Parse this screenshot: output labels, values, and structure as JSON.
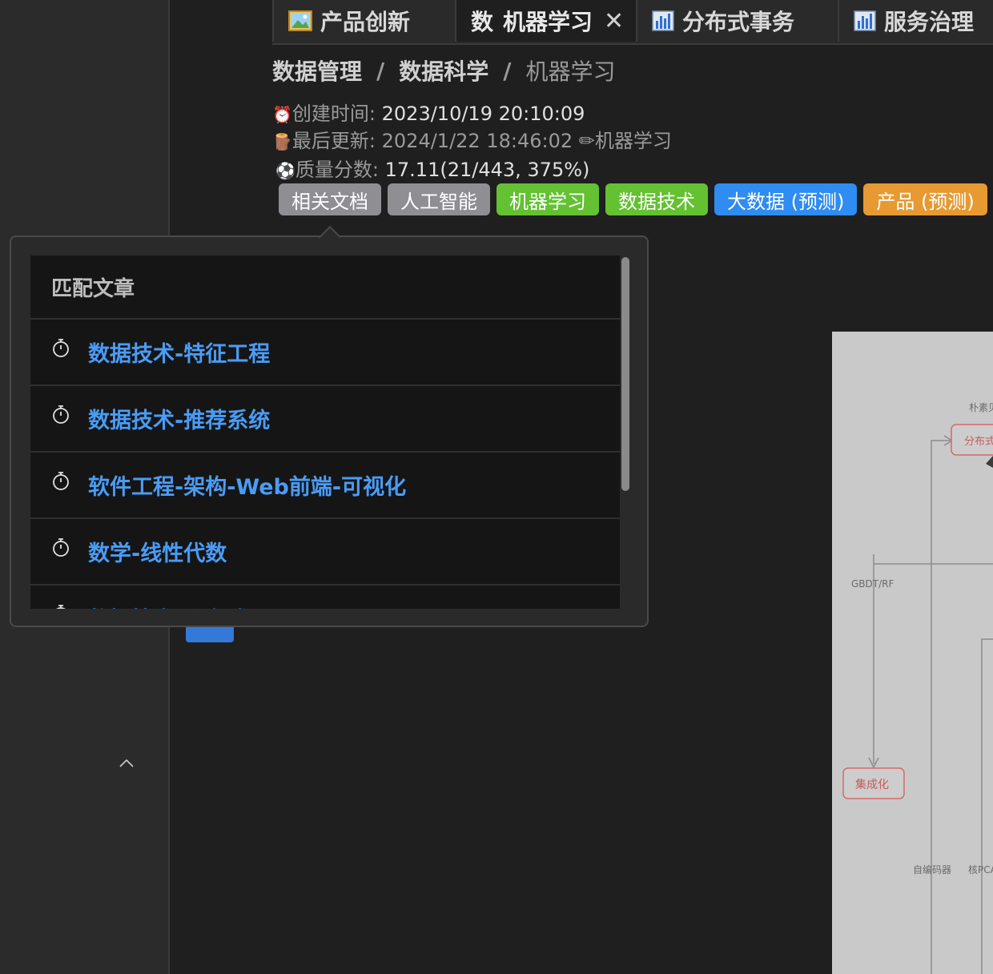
{
  "tabs": [
    {
      "label": "产品创新",
      "icon": "image-icon",
      "active": false
    },
    {
      "label": "机器学习",
      "abbr": "数",
      "active": true,
      "close": "✕"
    },
    {
      "label": "分布式事务",
      "icon": "bar-chart-icon",
      "active": false
    },
    {
      "label": "服务治理",
      "icon": "bar-chart-icon",
      "active": false
    }
  ],
  "breadcrumb": [
    "数据管理",
    "数据科学",
    "机器学习"
  ],
  "breadcrumb_sep": "/",
  "meta": {
    "created_label": "创建时间:",
    "created_value": "2023/10/19 20:10:09",
    "updated_label": "最后更新:",
    "updated_value": "2024/1/22 18:46:02",
    "updated_by": "机器学习",
    "quality_label": "质量分数:",
    "quality_value": "17.11(21/443, 375%)",
    "created_emoji": "⏰",
    "updated_emoji": "🪵",
    "pencil": "✏",
    "quality_emoji": "⚽"
  },
  "tags": [
    {
      "label": "相关文档",
      "color": "#8e8e93"
    },
    {
      "label": "人工智能",
      "color": "#8e8e93"
    },
    {
      "label": "机器学习",
      "color": "#63c132"
    },
    {
      "label": "数据技术",
      "color": "#63c132"
    },
    {
      "label": "大数据 (预测)",
      "color": "#2f8cf0"
    },
    {
      "label": "产品 (预测)",
      "color": "#e69a31"
    }
  ],
  "popover": {
    "title": "匹配文章",
    "items": [
      "数据技术-特征工程",
      "数据技术-推荐系统",
      "软件工程-架构-Web前端-可视化",
      "数学-线性代数",
      "数据技术-分布式"
    ]
  },
  "diagram": {
    "labels": [
      "朴素贝",
      "分布式",
      "GBDT/RF",
      "集成化",
      "自编码器",
      "核PCA"
    ]
  },
  "colors": {
    "link": "#4a9cf5",
    "background": "#1f1f1f",
    "sidebar": "#2b2b2b"
  }
}
